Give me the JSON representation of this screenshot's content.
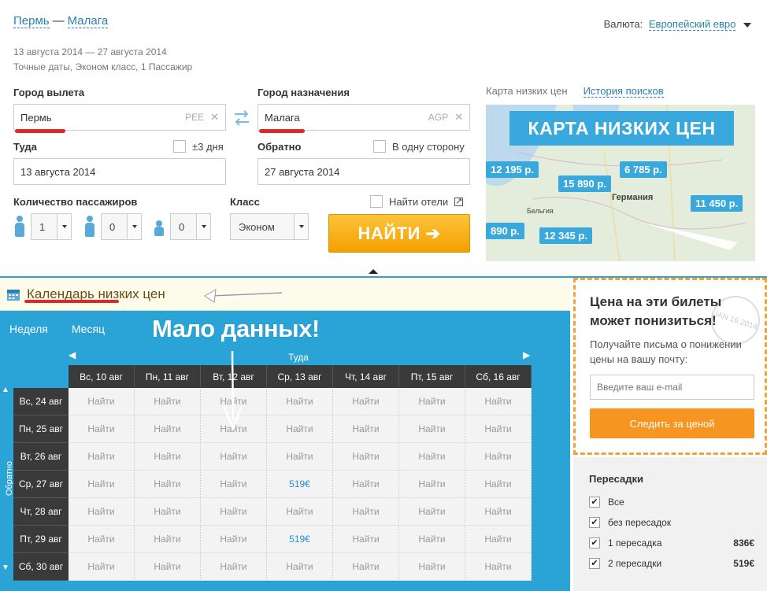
{
  "route": {
    "from": "Пермь",
    "sep": "—",
    "to": "Малага"
  },
  "dates_line": "13 августа 2014 — 27 августа 2014",
  "details_line": "Точные даты, Эконом класс, 1 Пассажир",
  "currency": {
    "label": "Валюта:",
    "value": "Европейский евро"
  },
  "form": {
    "from_label": "Город вылета",
    "from_value": "Пермь",
    "from_code": "PEE",
    "to_label": "Город назначения",
    "to_value": "Малага",
    "to_code": "AGP",
    "depart_label": "Туда",
    "flex_label": "±3 дня",
    "depart_value": "13 августа 2014",
    "return_label": "Обратно",
    "oneway_label": "В одну сторону",
    "return_value": "27 августа 2014",
    "passengers_label": "Количество пассажиров",
    "adults": "1",
    "children": "0",
    "infants": "0",
    "class_label": "Класс",
    "class_value": "Эконом",
    "hotels_label": "Найти отели",
    "search_button": "НАЙТИ ➔"
  },
  "map": {
    "tab1": "Карта низких цен",
    "tab2": "История поисков",
    "title": "КАРТА НИЗКИХ ЦЕН",
    "prices": [
      "12 195 р.",
      "6 785 р.",
      "15 890 р.",
      "11 450 р.",
      "890 р.",
      "12 345 р."
    ],
    "place_labels": [
      "Германия",
      "Бельгия"
    ]
  },
  "calendar": {
    "title": "Календарь низких цен",
    "tab_week": "Неделя",
    "tab_month": "Месяц",
    "annotation": "Мало данных!",
    "axis_x": "Туда",
    "axis_y": "Обратно",
    "columns": [
      "Вс, 10 авг",
      "Пн, 11 авг",
      "Вт, 12 авг",
      "Ср, 13 авг",
      "Чт, 14 авг",
      "Пт, 15 авг",
      "Сб, 16 авг"
    ],
    "rows": [
      {
        "label": "Вс, 24 авг",
        "cells": [
          "Найти",
          "Найти",
          "Найти",
          "Найти",
          "Найти",
          "Найти",
          "Найти"
        ]
      },
      {
        "label": "Пн, 25 авг",
        "cells": [
          "Найти",
          "Найти",
          "Найти",
          "Найти",
          "Найти",
          "Найти",
          "Найти"
        ]
      },
      {
        "label": "Вт, 26 авг",
        "cells": [
          "Найти",
          "Найти",
          "Найти",
          "Найти",
          "Найти",
          "Найти",
          "Найти"
        ]
      },
      {
        "label": "Ср, 27 авг",
        "cells": [
          "Найти",
          "Найти",
          "Найти",
          "519€",
          "Найти",
          "Найти",
          "Найти"
        ]
      },
      {
        "label": "Чт, 28 авг",
        "cells": [
          "Найти",
          "Найти",
          "Найти",
          "Найти",
          "Найти",
          "Найти",
          "Найти"
        ]
      },
      {
        "label": "Пт, 29 авг",
        "cells": [
          "Найти",
          "Найти",
          "Найти",
          "519€",
          "Найти",
          "Найти",
          "Найти"
        ]
      },
      {
        "label": "Сб, 30 авг",
        "cells": [
          "Найти",
          "Найти",
          "Найти",
          "Найти",
          "Найти",
          "Найти",
          "Найти"
        ]
      }
    ]
  },
  "subscribe": {
    "title_line1": "Цена на эти билеты",
    "title_line2": "может понизиться!",
    "text": "Получайте письма о понижении цены на вашу почту:",
    "placeholder": "Введите ваш e-mail",
    "button": "Следить за ценой",
    "stamp": "JAN 16 2014"
  },
  "stops": {
    "title": "Пересадки",
    "options": [
      {
        "label": "Все",
        "price": ""
      },
      {
        "label": "без пересадок",
        "price": ""
      },
      {
        "label": "1 пересадка",
        "price": "836€"
      },
      {
        "label": "2 пересадки",
        "price": "519€"
      }
    ]
  },
  "colors": {
    "accent": "#2aa3d6",
    "orange": "#f79521",
    "red_marker": "#e0282b"
  }
}
